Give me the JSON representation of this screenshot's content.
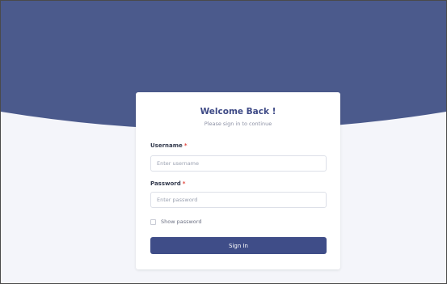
{
  "colors": {
    "hero": "#4b5a8c",
    "page_background": "#f4f5fa",
    "card": "#ffffff",
    "accent": "#3f4d88",
    "title": "#3e4a86",
    "required": "#e2453c"
  },
  "login": {
    "title": "Welcome Back !",
    "subtitle": "Please sign in to continue",
    "username": {
      "label": "Username",
      "required_marker": "*",
      "placeholder": "Enter username",
      "value": ""
    },
    "password": {
      "label": "Password",
      "required_marker": "*",
      "placeholder": "Enter password",
      "value": ""
    },
    "show_password": {
      "label": "Show password",
      "checked": false
    },
    "submit_label": "Sign In"
  }
}
